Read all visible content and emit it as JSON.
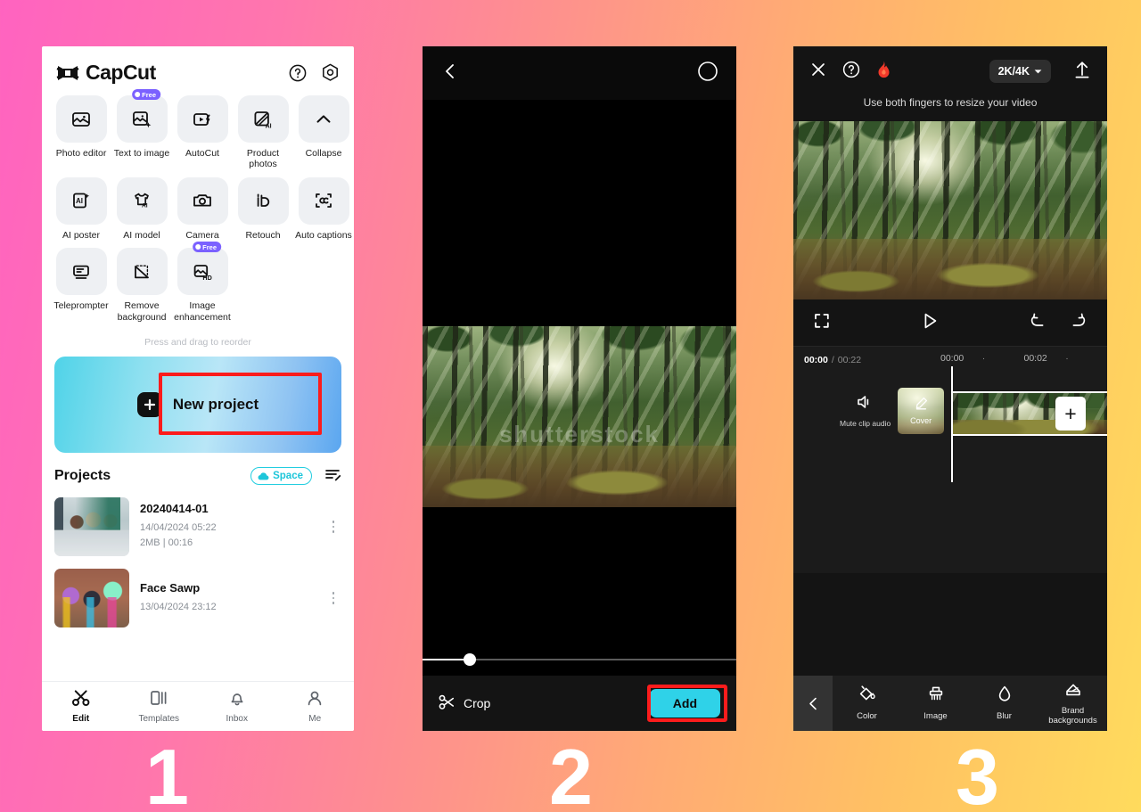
{
  "background": {
    "gradient_from": "#ff63c0",
    "gradient_mid": "#ffab74",
    "gradient_to": "#ffdb5d"
  },
  "steps": {
    "one": "1",
    "two": "2",
    "three": "3"
  },
  "panel1": {
    "app_name": "CapCut",
    "header_icons": [
      "help-icon",
      "settings-icon"
    ],
    "tools": [
      {
        "label": "Photo editor",
        "icon": "photo-editor-icon",
        "badge": null
      },
      {
        "label": "Text to image",
        "icon": "text-to-image-icon",
        "badge": "Free"
      },
      {
        "label": "AutoCut",
        "icon": "autocut-icon",
        "badge": null
      },
      {
        "label": "Product photos",
        "icon": "product-photos-icon",
        "badge": null
      },
      {
        "label": "Collapse",
        "icon": "chevron-up-icon",
        "badge": null
      },
      {
        "label": "AI poster",
        "icon": "ai-poster-icon",
        "badge": null
      },
      {
        "label": "AI model",
        "icon": "ai-model-icon",
        "badge": null
      },
      {
        "label": "Camera",
        "icon": "camera-icon",
        "badge": null
      },
      {
        "label": "Retouch",
        "icon": "retouch-icon",
        "badge": null
      },
      {
        "label": "Auto captions",
        "icon": "auto-captions-icon",
        "badge": null
      },
      {
        "label": "Teleprompter",
        "icon": "teleprompter-icon",
        "badge": null
      },
      {
        "label": "Remove background",
        "icon": "remove-background-icon",
        "badge": null
      },
      {
        "label": "Image enhancement",
        "icon": "image-enhancement-icon",
        "badge": "Free"
      }
    ],
    "reorder_hint": "Press and drag to reorder",
    "new_project_label": "New project",
    "projects_title": "Projects",
    "space_label": "Space",
    "projects": [
      {
        "name": "20240414-01",
        "date": "14/04/2024 05:22",
        "size": "2MB",
        "separator": "|",
        "duration": "00:16"
      },
      {
        "name": "Face Sawp",
        "date": "13/04/2024 23:12",
        "size": "",
        "separator": "",
        "duration": ""
      }
    ],
    "tabs": [
      {
        "label": "Edit",
        "icon": "scissors-icon",
        "active": true
      },
      {
        "label": "Templates",
        "icon": "templates-icon",
        "active": false
      },
      {
        "label": "Inbox",
        "icon": "bell-icon",
        "active": false
      },
      {
        "label": "Me",
        "icon": "person-icon",
        "active": false
      }
    ]
  },
  "panel2": {
    "back_icon": "chevron-left-icon",
    "select_icon": "circle-select-icon",
    "crop_label": "Crop",
    "add_label": "Add",
    "accent_color": "#2fd2e8",
    "highlight_color": "#fc1c1c"
  },
  "panel3": {
    "close_icon": "close-icon",
    "help_icon": "help-icon",
    "flame_icon": "flame-icon",
    "resolution": "2K/4K",
    "export_icon": "export-upload-icon",
    "hint": "Use both fingers to resize your video",
    "fullscreen_icon": "fullscreen-icon",
    "play_icon": "play-icon",
    "undo_icon": "undo-icon",
    "redo_icon": "redo-icon",
    "time_current": "00:00",
    "time_separator": "/",
    "time_total": "00:22",
    "ruler": [
      "00:00",
      "·",
      "00:02",
      "·"
    ],
    "mute_label": "Mute clip audio",
    "cover_label": "Cover",
    "add_clip_label": "+",
    "tools": [
      {
        "label": "Color",
        "icon": "paint-bucket-icon"
      },
      {
        "label": "Image",
        "icon": "brush-icon"
      },
      {
        "label": "Blur",
        "icon": "droplet-icon"
      },
      {
        "label": "Brand backgrounds",
        "icon": "brand-backgrounds-icon"
      }
    ],
    "back_icon": "chevron-left-icon"
  }
}
